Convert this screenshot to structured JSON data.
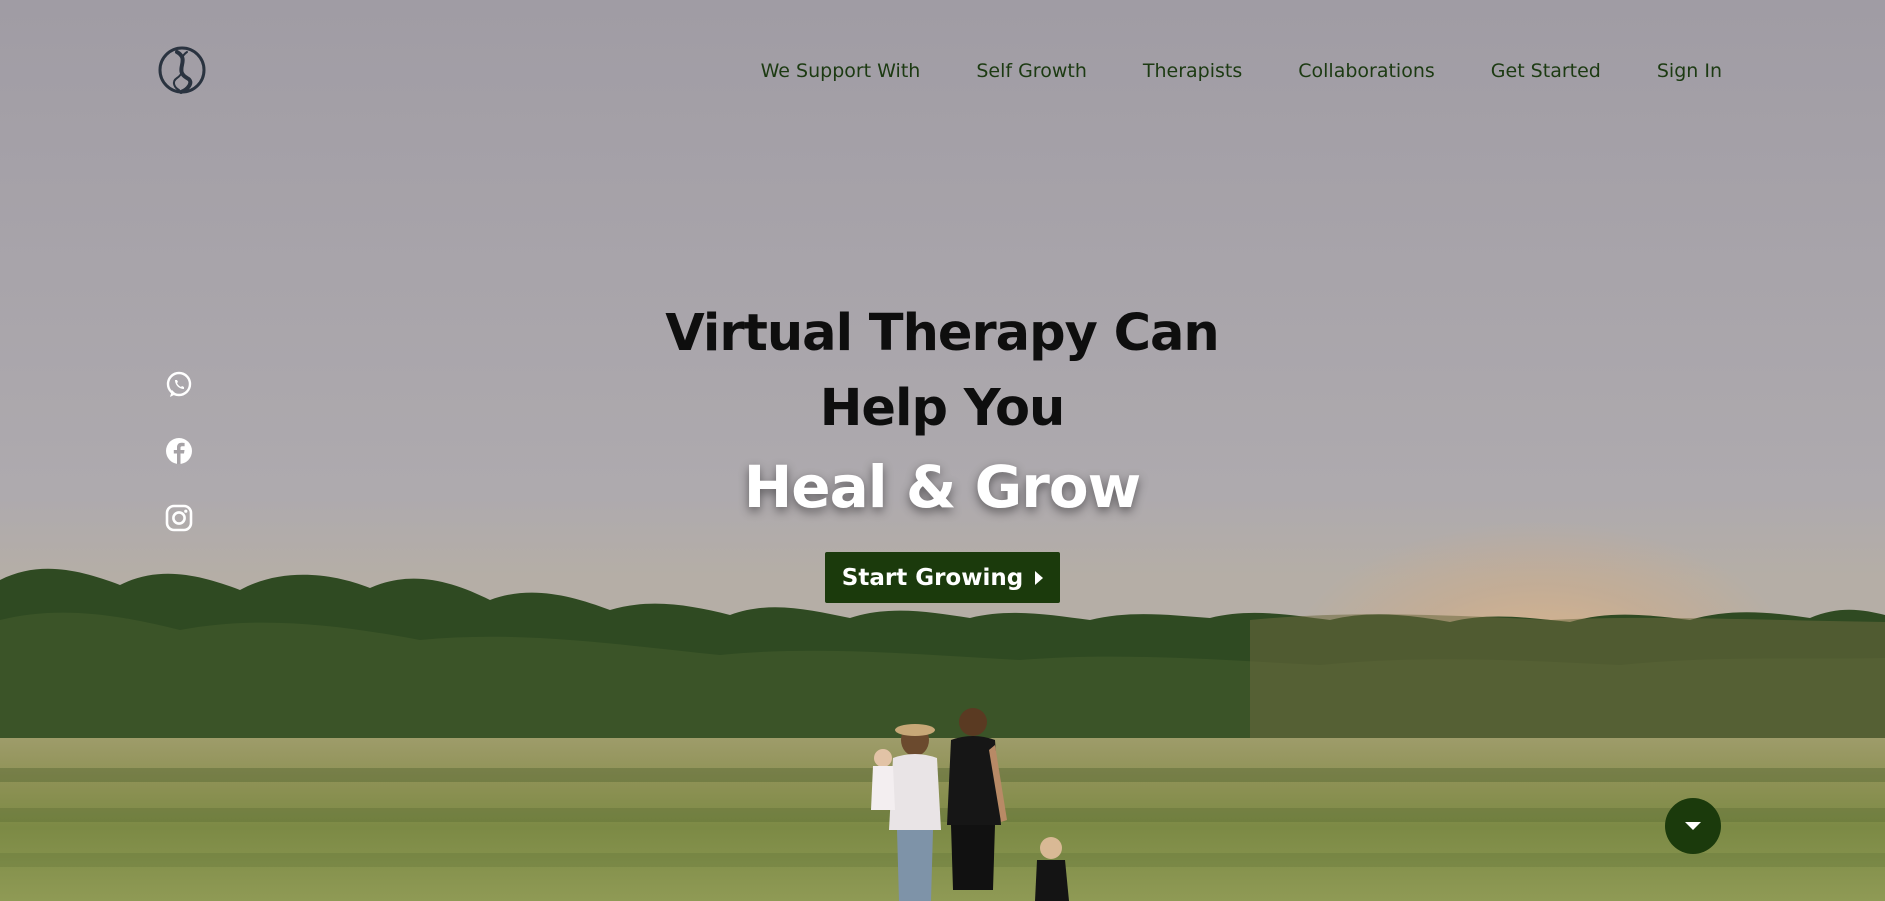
{
  "brand": {
    "logo_icon": "dna-helix-logo-icon"
  },
  "nav": {
    "items": [
      {
        "label": "We Support With"
      },
      {
        "label": "Self Growth"
      },
      {
        "label": "Therapists"
      },
      {
        "label": "Collaborations"
      },
      {
        "label": "Get Started"
      },
      {
        "label": "Sign In"
      }
    ]
  },
  "social": {
    "icons": [
      "whatsapp-icon",
      "facebook-icon",
      "instagram-icon"
    ]
  },
  "hero": {
    "line1": "Virtual Therapy Can",
    "line2": "Help You",
    "accent": "Heal & Grow",
    "cta_label": "Start Growing"
  },
  "scroll": {
    "icon": "chevron-down-icon"
  },
  "colors": {
    "brand_green": "#1b3a0c",
    "nav_text": "#1c3a12",
    "headline_text": "#0e0e0e",
    "accent_text": "#ffffff"
  }
}
